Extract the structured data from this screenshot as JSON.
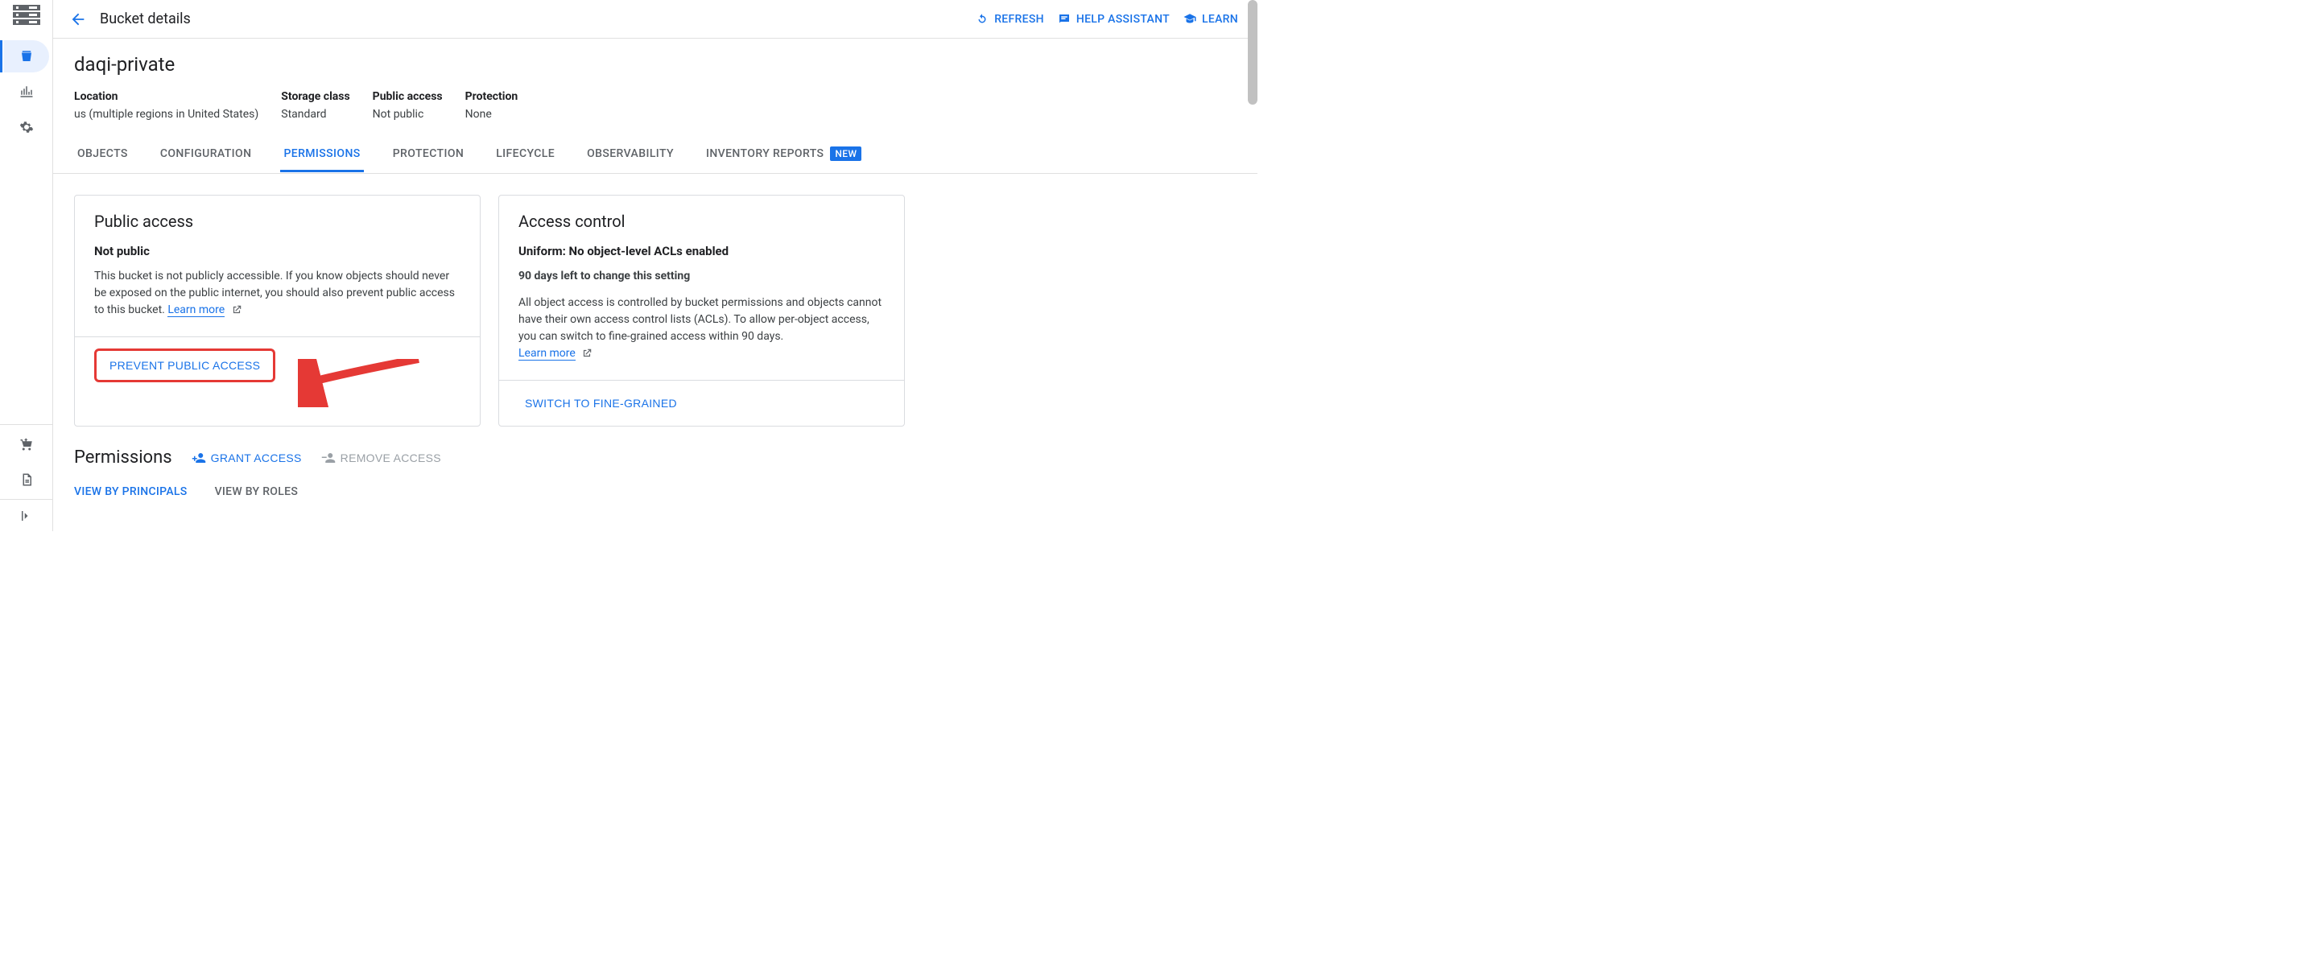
{
  "header": {
    "title": "Bucket details",
    "actions": {
      "refresh": "REFRESH",
      "help": "HELP ASSISTANT",
      "learn": "LEARN"
    }
  },
  "bucket": {
    "name": "daqi-private",
    "meta": [
      {
        "label": "Location",
        "value": "us (multiple regions in United States)"
      },
      {
        "label": "Storage class",
        "value": "Standard"
      },
      {
        "label": "Public access",
        "value": "Not public"
      },
      {
        "label": "Protection",
        "value": "None"
      }
    ]
  },
  "tabs": [
    {
      "label": "OBJECTS"
    },
    {
      "label": "CONFIGURATION"
    },
    {
      "label": "PERMISSIONS",
      "active": true
    },
    {
      "label": "PROTECTION"
    },
    {
      "label": "LIFECYCLE"
    },
    {
      "label": "OBSERVABILITY"
    },
    {
      "label": "INVENTORY REPORTS",
      "badge": "NEW"
    }
  ],
  "cards": {
    "public_access": {
      "title": "Public access",
      "subtitle": "Not public",
      "text": "This bucket is not publicly accessible. If you know objects should never be exposed on the public internet, you should also prevent public access to this bucket.",
      "learn_more": "Learn more",
      "button": "PREVENT PUBLIC ACCESS"
    },
    "access_control": {
      "title": "Access control",
      "subtitle": "Uniform: No object-level ACLs enabled",
      "note": "90 days left to change this setting",
      "text": "All object access is controlled by bucket permissions and objects cannot have their own access control lists (ACLs). To allow per-object access, you can switch to fine-grained access within 90 days.",
      "learn_more": "Learn more",
      "button": "SWITCH TO FINE-GRAINED"
    }
  },
  "permissions": {
    "title": "Permissions",
    "grant": "GRANT ACCESS",
    "remove": "REMOVE ACCESS",
    "subtabs": {
      "principals": "VIEW BY PRINCIPALS",
      "roles": "VIEW BY ROLES"
    }
  }
}
